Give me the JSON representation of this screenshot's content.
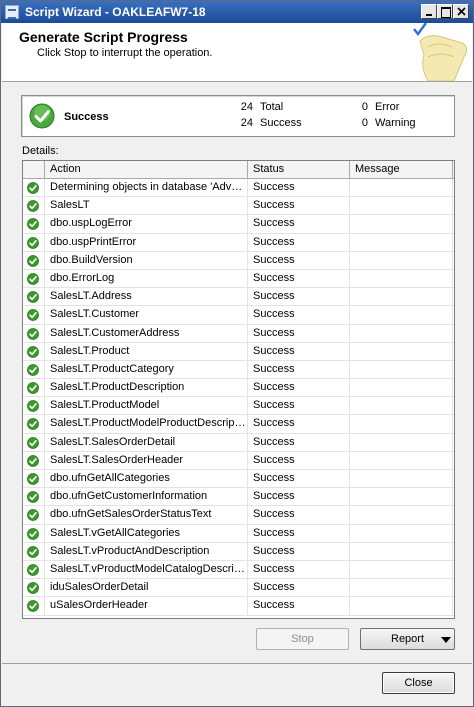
{
  "window": {
    "title": "Script Wizard - OAKLEAFW7-18"
  },
  "header": {
    "title": "Generate Script Progress",
    "subtitle": "Click Stop to interrupt the operation."
  },
  "summary": {
    "status": "Success",
    "total_count": "24",
    "total_label": "Total",
    "success_count": "24",
    "success_label": "Success",
    "error_count": "0",
    "error_label": "Error",
    "warning_count": "0",
    "warning_label": "Warning"
  },
  "details": {
    "label": "Details:",
    "columns": {
      "action": "Action",
      "status": "Status",
      "message": "Message"
    },
    "rows": [
      {
        "action": "Determining objects in database 'Adven...",
        "status": "Success",
        "message": ""
      },
      {
        "action": "SalesLT",
        "status": "Success",
        "message": ""
      },
      {
        "action": "dbo.uspLogError",
        "status": "Success",
        "message": ""
      },
      {
        "action": "dbo.uspPrintError",
        "status": "Success",
        "message": ""
      },
      {
        "action": "dbo.BuildVersion",
        "status": "Success",
        "message": ""
      },
      {
        "action": "dbo.ErrorLog",
        "status": "Success",
        "message": ""
      },
      {
        "action": "SalesLT.Address",
        "status": "Success",
        "message": ""
      },
      {
        "action": "SalesLT.Customer",
        "status": "Success",
        "message": ""
      },
      {
        "action": "SalesLT.CustomerAddress",
        "status": "Success",
        "message": ""
      },
      {
        "action": "SalesLT.Product",
        "status": "Success",
        "message": ""
      },
      {
        "action": "SalesLT.ProductCategory",
        "status": "Success",
        "message": ""
      },
      {
        "action": "SalesLT.ProductDescription",
        "status": "Success",
        "message": ""
      },
      {
        "action": "SalesLT.ProductModel",
        "status": "Success",
        "message": ""
      },
      {
        "action": "SalesLT.ProductModelProductDescription",
        "status": "Success",
        "message": ""
      },
      {
        "action": "SalesLT.SalesOrderDetail",
        "status": "Success",
        "message": ""
      },
      {
        "action": "SalesLT.SalesOrderHeader",
        "status": "Success",
        "message": ""
      },
      {
        "action": "dbo.ufnGetAllCategories",
        "status": "Success",
        "message": ""
      },
      {
        "action": "dbo.ufnGetCustomerInformation",
        "status": "Success",
        "message": ""
      },
      {
        "action": "dbo.ufnGetSalesOrderStatusText",
        "status": "Success",
        "message": ""
      },
      {
        "action": "SalesLT.vGetAllCategories",
        "status": "Success",
        "message": ""
      },
      {
        "action": "SalesLT.vProductAndDescription",
        "status": "Success",
        "message": ""
      },
      {
        "action": "SalesLT.vProductModelCatalogDescript...",
        "status": "Success",
        "message": ""
      },
      {
        "action": "iduSalesOrderDetail",
        "status": "Success",
        "message": ""
      },
      {
        "action": "uSalesOrderHeader",
        "status": "Success",
        "message": ""
      }
    ]
  },
  "buttons": {
    "stop": "Stop",
    "report": "Report",
    "close": "Close"
  },
  "colors": {
    "success_green": "#3a9a2a",
    "titlebar": "#1c4a98"
  },
  "icons": {
    "row_status": "success-check-icon",
    "summary_status": "success-check-icon"
  }
}
